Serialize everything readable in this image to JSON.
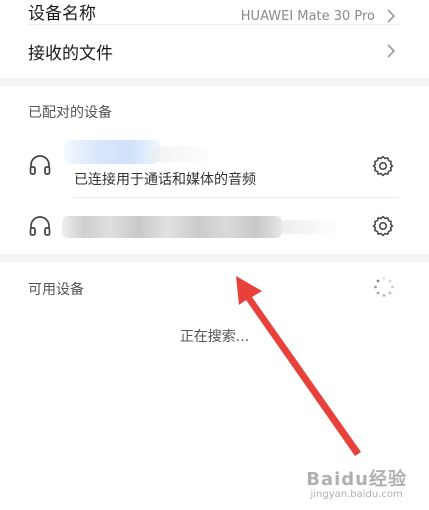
{
  "settings": {
    "device_name_label": "设备名称",
    "device_name_value": "HUAWEI Mate 30 Pro",
    "received_files_label": "接收的文件"
  },
  "paired": {
    "section_title": "已配对的设备",
    "devices": [
      {
        "status": "已连接用于通话和媒体的音频"
      },
      {
        "status": ""
      }
    ]
  },
  "available": {
    "section_title": "可用设备",
    "searching_text": "正在搜索..."
  },
  "watermark": {
    "main": "Baidu经验",
    "sub": "jingyan.baidu.com"
  },
  "colors": {
    "arrow": "#e8403b",
    "section_bg": "#f4f4f4"
  }
}
